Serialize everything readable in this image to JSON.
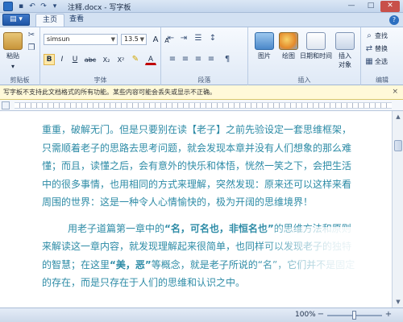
{
  "window": {
    "title": "注释.docx - 写字板",
    "minimize_glyph": "—",
    "maximize_glyph": "□",
    "close_glyph": "✕",
    "qat_save_icon": "save-icon",
    "qat_undo_icon": "undo-icon",
    "qat_redo_icon": "redo-icon"
  },
  "ribbon": {
    "app_menu_label": "▤ ▾",
    "tabs": [
      {
        "label": "主页",
        "selected": true
      },
      {
        "label": "查看",
        "selected": false
      }
    ],
    "help_label": "?",
    "clipboard": {
      "group_label": "剪贴板",
      "paste_label": "粘贴",
      "paste_dropdown": "▾"
    },
    "font": {
      "group_label": "字体",
      "font_family": "simsun",
      "font_size": "13.5",
      "bold": "B",
      "italic": "I",
      "underline": "U",
      "strikethrough": "abc",
      "subscript": "X₂",
      "superscript": "X²",
      "grow": "A",
      "shrink": "A",
      "font_color": "A",
      "highlight_color": "#ffff00",
      "font_color_value": "#c00000"
    },
    "paragraph": {
      "group_label": "段落"
    },
    "insert": {
      "group_label": "插入",
      "picture_label": "图片",
      "paint_label": "绘图",
      "datetime_label": "日期和时间",
      "object_label_1": "插入",
      "object_label_2": "对象"
    },
    "editing": {
      "group_label": "编辑",
      "find_label": "查找",
      "replace_label": "替换",
      "select_all_label": "全选"
    }
  },
  "infobar": {
    "message": "写字板不支持此文档格式的所有功能。某些内容可能会丢失或显示不正确。",
    "close_glyph": "×"
  },
  "document": {
    "paragraphs": [
      [
        {
          "text": "重重，破解无门。但是只要别在读【老子】之前先验设定一套思维框架，只需顺着老子的思路去思考问题，就会发现本章并没有人们想象的那么难懂；而且，读懂之后，会有意外的快乐和体悟，恍然一笑之下，会把生活中的很多事情，也用相同的方式来理解，突然发现：原来还可以这样来看周围的世界：这是一种令人心情愉快的，极为开阔的思维境界！",
          "bold": false
        }
      ],
      [
        {
          "text": "用老子道篇第一章中的",
          "bold": false
        },
        {
          "text": "“名，可名也，非恒名也”",
          "bold": true
        },
        {
          "text": "的思维方法和原则来解读这一章内容，就发现理解起来很简单，也同样可以发现老子的独特的智慧；在这里",
          "bold": false
        },
        {
          "text": "“美，恶”",
          "bold": true
        },
        {
          "text": "等概念，就是老子所说的“名”，它们并不是固定的存在，而是只存在于人们的思维和认识之中。",
          "bold": false
        }
      ]
    ]
  },
  "statusbar": {
    "zoom": "100%",
    "zoom_minus": "−",
    "zoom_plus": "+",
    "zoom_fraction": 0.5
  }
}
